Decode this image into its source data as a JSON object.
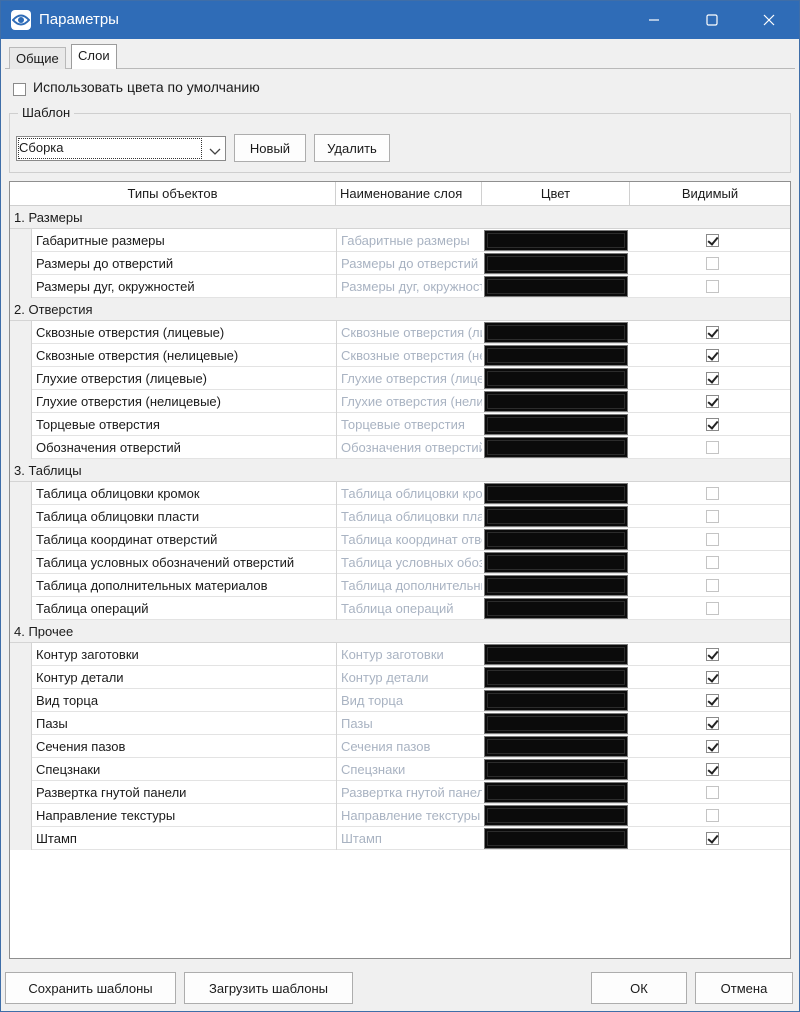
{
  "window": {
    "title": "Параметры",
    "accent": "#2f6cb7",
    "icons": {
      "app": "eye-icon",
      "minimize": "minimize-icon",
      "maximize": "maximize-icon",
      "close": "close-icon"
    }
  },
  "tabs": [
    {
      "label": "Общие",
      "active": false
    },
    {
      "label": "Слои",
      "active": true
    }
  ],
  "use_default_colors": {
    "label": "Использовать цвета по умолчанию",
    "checked": false
  },
  "template": {
    "legend": "Шаблон",
    "selected": "Сборка",
    "new_label": "Новый",
    "delete_label": "Удалить"
  },
  "grid": {
    "headers": {
      "type": "Типы объектов",
      "name": "Наименование слоя",
      "color": "Цвет",
      "visible": "Видимый"
    },
    "groups": [
      {
        "label": "1. Размеры",
        "rows": [
          {
            "type": "Габаритные размеры",
            "name": "Габаритные размеры",
            "visible": true
          },
          {
            "type": "Размеры до отверстий",
            "name": "Размеры до отверстий",
            "visible": false
          },
          {
            "type": "Размеры дуг, окружностей",
            "name": "Размеры дуг, окружностей",
            "visible": false
          }
        ]
      },
      {
        "label": "2. Отверстия",
        "rows": [
          {
            "type": "Сквозные отверстия (лицевые)",
            "name": "Сквозные отверстия (лицевые)",
            "visible": true
          },
          {
            "type": "Сквозные отверстия (нелицевые)",
            "name": "Сквозные отверстия (нелицевые)",
            "visible": true
          },
          {
            "type": "Глухие отверстия (лицевые)",
            "name": "Глухие отверстия (лицевые)",
            "visible": true
          },
          {
            "type": "Глухие отверстия (нелицевые)",
            "name": "Глухие отверстия (нелицевые)",
            "visible": true
          },
          {
            "type": "Торцевые отверстия",
            "name": "Торцевые отверстия",
            "visible": true
          },
          {
            "type": "Обозначения отверстий",
            "name": "Обозначения отверстий",
            "visible": false
          }
        ]
      },
      {
        "label": "3. Таблицы",
        "rows": [
          {
            "type": "Таблица облицовки кромок",
            "name": "Таблица облицовки кромок",
            "visible": false
          },
          {
            "type": "Таблица облицовки пласти",
            "name": "Таблица облицовки пласти",
            "visible": false
          },
          {
            "type": "Таблица координат отверстий",
            "name": "Таблица координат отверстий",
            "visible": false
          },
          {
            "type": "Таблица условных обозначений отверстий",
            "name": "Таблица условных обозначений отверстий",
            "visible": false
          },
          {
            "type": "Таблица дополнительных материалов",
            "name": "Таблица дополнительных материалов",
            "visible": false
          },
          {
            "type": "Таблица операций",
            "name": "Таблица операций",
            "visible": false
          }
        ]
      },
      {
        "label": "4. Прочее",
        "rows": [
          {
            "type": "Контур заготовки",
            "name": "Контур заготовки",
            "visible": true
          },
          {
            "type": "Контур детали",
            "name": "Контур детали",
            "visible": true
          },
          {
            "type": "Вид торца",
            "name": "Вид торца",
            "visible": true
          },
          {
            "type": "Пазы",
            "name": "Пазы",
            "visible": true
          },
          {
            "type": "Сечения пазов",
            "name": "Сечения пазов",
            "visible": true
          },
          {
            "type": "Спецзнаки",
            "name": "Спецзнаки",
            "visible": true
          },
          {
            "type": "Развертка гнутой панели",
            "name": "Развертка гнутой панели",
            "visible": false
          },
          {
            "type": "Направление текстуры",
            "name": "Направление текстуры",
            "visible": false
          },
          {
            "type": "Штамп",
            "name": "Штамп",
            "visible": true
          }
        ]
      }
    ],
    "layer_color": "#0b0b0b"
  },
  "footer": {
    "save_label": "Сохранить шаблоны",
    "load_label": "Загрузить шаблоны",
    "ok_label": "ОК",
    "cancel_label": "Отмена"
  }
}
